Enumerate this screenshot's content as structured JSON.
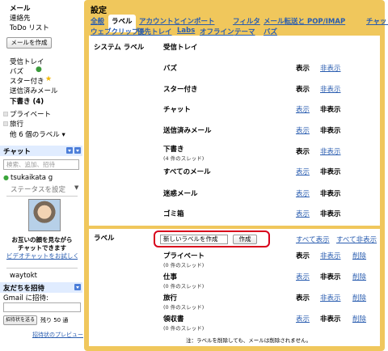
{
  "sidebar": {
    "links": [
      {
        "label": "メール",
        "bold": true
      },
      {
        "label": "連絡先",
        "bold": false
      },
      {
        "label": "ToDo リスト",
        "bold": false
      }
    ],
    "compose_label": "メールを作成",
    "folders": [
      {
        "label": "受信トレイ"
      },
      {
        "label": "バズ"
      },
      {
        "label": "スター付き"
      },
      {
        "label": "送信済みメール"
      },
      {
        "label": "下書き (4)"
      }
    ],
    "user_labels": [
      "プライベート",
      "旅行"
    ],
    "more_labels": "他 6 個のラベル ▾",
    "chat": {
      "title": "チャット",
      "search_placeholder": "検索、追加、招待",
      "user_name": "tsukaikata g",
      "status": "ステータスを設定",
      "video_line1": "お互いの顔を見ながら",
      "video_line2": "チャットできます",
      "video_link": "ビデオチャットをお試しください",
      "contact": "waytokt"
    },
    "invite": {
      "title": "友だちを招待",
      "field_label": "Gmail に招待:",
      "button": "招待状を送る",
      "remaining": "残り 50 通",
      "preview_link": "招待状のプレビュー"
    }
  },
  "settings": {
    "title": "設定",
    "tabs": [
      {
        "label": "全般",
        "active": false
      },
      {
        "label": "ラベル",
        "active": true
      },
      {
        "label": "アカウントとインポート",
        "active": false
      },
      {
        "label": "フィルタ",
        "active": false
      },
      {
        "label": "メール転送と POP/IMAP",
        "active": false
      },
      {
        "label": "チャット",
        "active": false
      },
      {
        "label": "ウェブクリップ",
        "active": false
      },
      {
        "label": "優先トレイ",
        "active": false
      },
      {
        "label": "Labs",
        "active": false
      },
      {
        "label": "オフライン",
        "active": false
      },
      {
        "label": "テーマ",
        "active": false
      },
      {
        "label": "バズ",
        "active": false
      }
    ],
    "system_section_title": "システム ラベル",
    "system_labels": [
      {
        "name": "受信トレイ",
        "sub": "",
        "show": "",
        "hide": ""
      },
      {
        "name": "バズ",
        "sub": "",
        "show": "表示",
        "hide": "非表示"
      },
      {
        "name": "スター付き",
        "sub": "",
        "show": "表示",
        "hide": "非表示"
      },
      {
        "name": "チャット",
        "sub": "",
        "show": "表示",
        "hide": "非表示"
      },
      {
        "name": "送信済みメール",
        "sub": "",
        "show": "表示",
        "hide": "非表示"
      },
      {
        "name": "下書き",
        "sub": "(4 件のスレッド)",
        "show": "表示",
        "hide": "非表示"
      },
      {
        "name": "すべてのメール",
        "sub": "",
        "show": "表示",
        "hide": "非表示"
      },
      {
        "name": "迷惑メール",
        "sub": "",
        "show": "表示",
        "hide": "非表示"
      },
      {
        "name": "ゴミ箱",
        "sub": "",
        "show": "表示",
        "hide": "非表示"
      }
    ],
    "user_section_title": "ラベル",
    "new_label_value": "新しいラベルを作成",
    "create_button": "作成",
    "show_all": "すべて表示",
    "hide_all": "すべて非表示",
    "user_labels": [
      {
        "name": "プライベート",
        "sub": "(0 件のスレッド)",
        "show": "表示",
        "hide": "非表示",
        "delete": "削除"
      },
      {
        "name": "仕事",
        "sub": "(0 件のスレッド)",
        "show": "表示",
        "hide": "非表示",
        "delete": "削除"
      },
      {
        "name": "旅行",
        "sub": "(0 件のスレッド)",
        "show": "表示",
        "hide": "非表示",
        "delete": "削除"
      },
      {
        "name": "領収書",
        "sub": "(0 件のスレッド)",
        "show": "表示",
        "hide": "非表示",
        "delete": "削除"
      }
    ],
    "note": "注：ラベルを削除しても、メールは削除されません。"
  },
  "colors": {
    "accent": "#f0c75c",
    "link": "#2a5db0",
    "highlight": "#d8001c"
  }
}
